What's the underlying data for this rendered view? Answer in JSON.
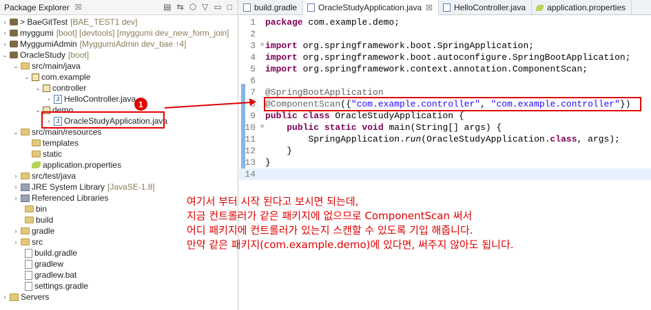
{
  "package_explorer": {
    "title": "Package Explorer",
    "close": "☒",
    "tree": [
      {
        "label": "BaeGitTest",
        "extra": "[BAE_TEST1 dev]",
        "prefix": ">",
        "icon": "project-icon"
      },
      {
        "label": "myggumi",
        "extra": "[boot] [devtools] [myggumi dev_new_form_join]",
        "icon": "project-icon"
      },
      {
        "label": "MyggumiAdmin",
        "extra": "[MyggumiAdmin dev_bae ↑4]",
        "icon": "project-icon"
      },
      {
        "label": "OracleStudy",
        "extra": "[boot]",
        "icon": "project-icon"
      },
      {
        "label": "src/main/java",
        "extra": "",
        "icon": "source-folder-icon"
      },
      {
        "label": "com.example",
        "extra": "",
        "icon": "package-icon"
      },
      {
        "label": "controller",
        "extra": "",
        "icon": "package-icon"
      },
      {
        "label": "HelloController.java",
        "extra": "",
        "icon": "java-file-icon"
      },
      {
        "label": "demo",
        "extra": "",
        "icon": "package-icon"
      },
      {
        "label": "OracleStudyApplication.java",
        "extra": "",
        "icon": "java-file-icon"
      },
      {
        "label": "src/main/resources",
        "extra": "",
        "icon": "source-folder-icon"
      },
      {
        "label": "templates",
        "extra": "",
        "icon": "folder-icon"
      },
      {
        "label": "static",
        "extra": "",
        "icon": "folder-icon"
      },
      {
        "label": "application.properties",
        "extra": "",
        "icon": "properties-icon"
      },
      {
        "label": "src/test/java",
        "extra": "",
        "icon": "source-folder-icon"
      },
      {
        "label": "JRE System Library",
        "extra": "[JavaSE-1.8]",
        "icon": "library-icon"
      },
      {
        "label": "Referenced Libraries",
        "extra": "",
        "icon": "library-icon"
      },
      {
        "label": "bin",
        "extra": "",
        "icon": "folder-icon"
      },
      {
        "label": "build",
        "extra": "",
        "icon": "folder-icon"
      },
      {
        "label": "gradle",
        "extra": "",
        "icon": "folder-icon"
      },
      {
        "label": "src",
        "extra": "",
        "icon": "folder-icon"
      },
      {
        "label": "build.gradle",
        "extra": "",
        "icon": "file-icon"
      },
      {
        "label": "gradlew",
        "extra": "",
        "icon": "file-icon"
      },
      {
        "label": "gradlew.bat",
        "extra": "",
        "icon": "file-icon"
      },
      {
        "label": "settings.gradle",
        "extra": "",
        "icon": "file-icon"
      },
      {
        "label": "Servers",
        "extra": "",
        "icon": "folder-icon"
      }
    ],
    "badge": "1"
  },
  "editor": {
    "tabs": [
      {
        "label": "build.gradle",
        "icon": "file-icon",
        "close": ""
      },
      {
        "label": "OracleStudyApplication.java",
        "icon": "java-file-icon",
        "close": "☒"
      },
      {
        "label": "HelloController.java",
        "icon": "java-file-icon",
        "close": ""
      },
      {
        "label": "application.properties",
        "icon": "properties-icon",
        "close": ""
      }
    ],
    "line_numbers": [
      "1",
      "2",
      "3",
      "4",
      "5",
      "6",
      "7",
      "8",
      "9",
      "10",
      "11",
      "12",
      "13",
      "14"
    ],
    "code": {
      "l1_kw": "package",
      "l1_rest": " com.example.demo;",
      "l3_kw": "import",
      "l3_rest": " org.springframework.boot.SpringApplication;",
      "l4_kw": "import",
      "l4_rest": " org.springframework.boot.autoconfigure.SpringBootApplication;",
      "l5_kw": "import",
      "l5_rest": " org.springframework.context.annotation.ComponentScan;",
      "l7_ann": "@SpringBootApplication",
      "l8_ann": "@ComponentScan",
      "l8_a": "({",
      "l8_s1": "\"com.example.controller\"",
      "l8_b": ", ",
      "l8_s2": "\"com.example.controller\"",
      "l8_c": "})",
      "l9_kw": "public class",
      "l9_rest": " OracleStudyApplication {",
      "l10_indent": "    ",
      "l10_kw": "public static void",
      "l10_rest": " main(String[] args) {",
      "l11_indent": "        ",
      "l11_a": "SpringApplication.",
      "l11_m": "run",
      "l11_b": "(OracleStudyApplication.",
      "l11_kw": "class",
      "l11_c": ", args);",
      "l12": "    }",
      "l13": "}"
    }
  },
  "note": [
    "여기서 부터 시작 된다고 보시면 되는데,",
    "지금 컨트롤러가 같은 패키지에 없으므로 ComponentScan 써서",
    "어디 패키지에 컨트롤러가 있는지 스캔할 수 있도록 기입 해줍니다.",
    "만약 같은 패키지(com.example.demo)에 있다면, 써주지 않아도 됩니다."
  ],
  "colors": {
    "highlight": "#e00000",
    "keyword": "#7f0055",
    "string": "#2a00ff",
    "annotation": "#646464"
  }
}
